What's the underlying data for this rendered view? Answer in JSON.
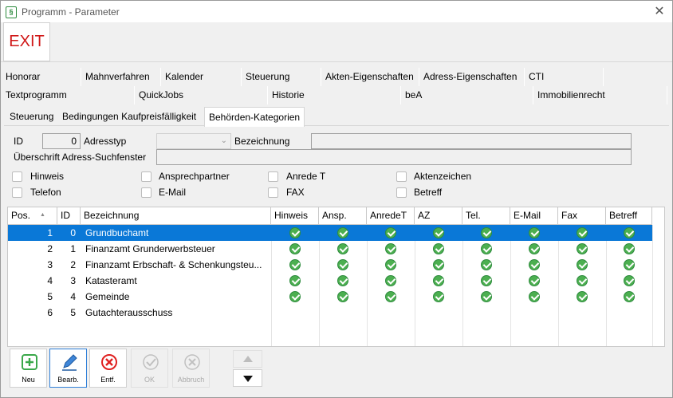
{
  "window": {
    "title": "Programm - Parameter",
    "app_icon": "§",
    "close_label": "✕"
  },
  "toolbar": {
    "exit_label": "EXIT"
  },
  "tabs_row1": [
    "Honorar",
    "Mahnverfahren",
    "Kalender",
    "Steuerung",
    "Akten-Eigenschaften",
    "Adress-Eigenschaften",
    "CTI"
  ],
  "tabs_row2": [
    "Textprogramm",
    "QuickJobs",
    "Historie",
    "beA",
    "Immobilienrecht"
  ],
  "subtabs": [
    "Steuerung",
    "Bedingungen Kaufpreisfälligkeit",
    "Behörden-Kategorien"
  ],
  "form": {
    "id_label": "ID",
    "id_value": "0",
    "adresstyp_label": "Adresstyp",
    "adresstyp_value": "",
    "bezeichnung_label": "Bezeichnung",
    "bezeichnung_value": "",
    "ueberschrift_label": "Überschrift Adress-Suchfenster",
    "ueberschrift_value": "",
    "checkboxes": [
      "Hinweis",
      "Ansprechpartner",
      "Anrede T",
      "Aktenzeichen",
      "Telefon",
      "E-Mail",
      "FAX",
      "Betreff"
    ]
  },
  "grid": {
    "headers": [
      "Pos.",
      "ID",
      "Bezeichnung",
      "Hinweis",
      "Ansp.",
      "AnredeT",
      "AZ",
      "Tel.",
      "E-Mail",
      "Fax",
      "Betreff"
    ],
    "sort_indicator": "▲",
    "rows": [
      {
        "pos": "1",
        "id": "0",
        "name": "Grundbuchamt",
        "flags": [
          1,
          1,
          1,
          1,
          1,
          1,
          1,
          1
        ]
      },
      {
        "pos": "2",
        "id": "1",
        "name": "Finanzamt Grunderwerbsteuer",
        "flags": [
          1,
          1,
          1,
          1,
          1,
          1,
          1,
          1
        ]
      },
      {
        "pos": "3",
        "id": "2",
        "name": "Finanzamt Erbschaft- & Schenkungsteu...",
        "flags": [
          1,
          1,
          1,
          1,
          1,
          1,
          1,
          1
        ]
      },
      {
        "pos": "4",
        "id": "3",
        "name": "Katasteramt",
        "flags": [
          1,
          1,
          1,
          1,
          1,
          1,
          1,
          1
        ]
      },
      {
        "pos": "5",
        "id": "4",
        "name": "Gemeinde",
        "flags": [
          1,
          1,
          1,
          1,
          1,
          1,
          1,
          1
        ]
      },
      {
        "pos": "6",
        "id": "5",
        "name": "Gutachterausschuss",
        "flags": [
          0,
          0,
          0,
          0,
          0,
          0,
          0,
          0
        ]
      }
    ],
    "selected_row": 0
  },
  "buttons": {
    "neu": "Neu",
    "bearb": "Bearb.",
    "entf": "Entf.",
    "ok": "OK",
    "abbruch": "Abbruch"
  },
  "colors": {
    "selection": "#0a78d7",
    "exit_text": "#d01818",
    "check": "#4caf50",
    "delete": "#e02020"
  }
}
